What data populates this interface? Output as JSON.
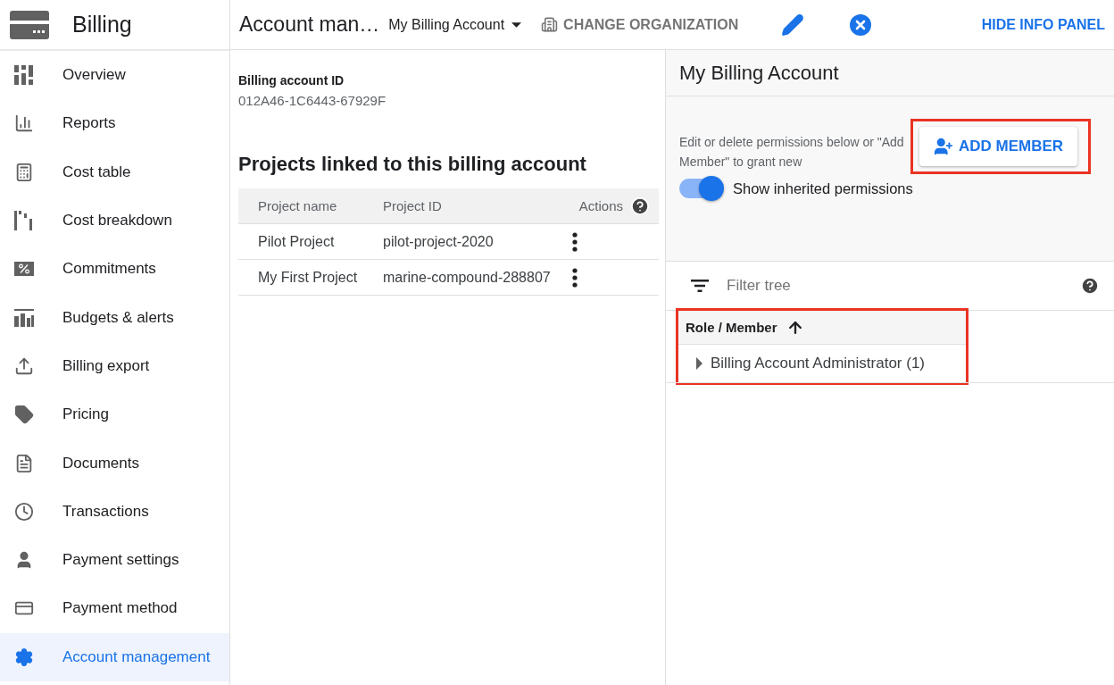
{
  "sidebar": {
    "title": "Billing",
    "items": [
      {
        "label": "Overview",
        "selected": false
      },
      {
        "label": "Reports",
        "selected": false
      },
      {
        "label": "Cost table",
        "selected": false
      },
      {
        "label": "Cost breakdown",
        "selected": false
      },
      {
        "label": "Commitments",
        "selected": false
      },
      {
        "label": "Budgets & alerts",
        "selected": false
      },
      {
        "label": "Billing export",
        "selected": false
      },
      {
        "label": "Pricing",
        "selected": false
      },
      {
        "label": "Documents",
        "selected": false
      },
      {
        "label": "Transactions",
        "selected": false
      },
      {
        "label": "Payment settings",
        "selected": false
      },
      {
        "label": "Payment method",
        "selected": false
      },
      {
        "label": "Account management",
        "selected": true
      }
    ]
  },
  "header": {
    "title": "Account man…",
    "account_selector": "My Billing Account",
    "change_org": "CHANGE ORGANIZATION",
    "hide_panel": "HIDE INFO PANEL"
  },
  "account": {
    "id_label": "Billing account ID",
    "id_value": "012A46-1C6443-67929F"
  },
  "projects": {
    "heading": "Projects linked to this billing account",
    "columns": [
      "Project name",
      "Project ID",
      "Actions"
    ],
    "rows": [
      {
        "name": "Pilot Project",
        "id": "pilot-project-2020"
      },
      {
        "name": "My First Project",
        "id": "marine-compound-288807"
      }
    ]
  },
  "info_panel": {
    "title": "My Billing Account",
    "hint": "Edit or delete permissions below or \"Add Member\" to grant new",
    "add_member": {
      "label": "ADD MEMBER",
      "highlighted": true
    },
    "inherited_toggle": {
      "label": "Show inherited permissions",
      "on": true
    },
    "filter": {
      "placeholder": "Filter tree"
    },
    "tree": {
      "highlighted": true,
      "column": "Role / Member",
      "rows": [
        {
          "label": "Billing Account Administrator (1)",
          "expanded": false
        }
      ]
    }
  }
}
